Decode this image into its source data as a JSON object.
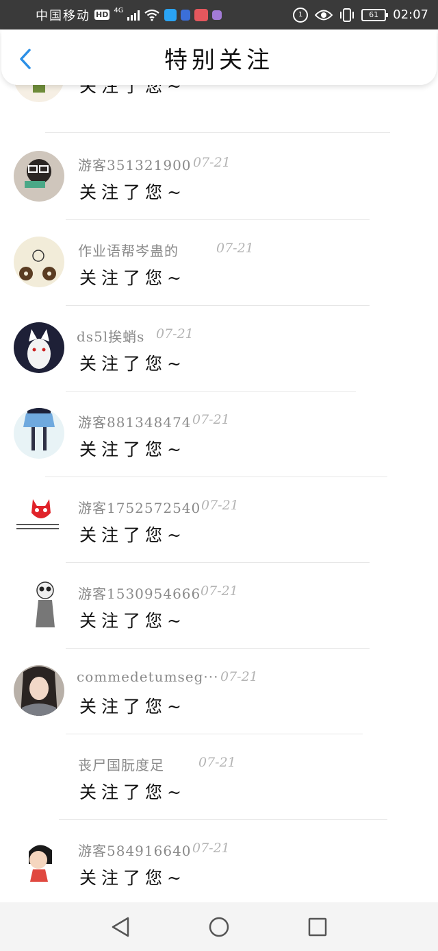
{
  "status_bar": {
    "carrier": "中国移动",
    "hd": "HD",
    "network": "4G",
    "battery": "61",
    "time": "02:07",
    "round_icon": "1"
  },
  "header": {
    "title": "特别关注",
    "back_icon": "chevron-left-icon",
    "accent": "#2b8fe6"
  },
  "follows": [
    {
      "name": "",
      "date": "",
      "message": "关注了您~",
      "avatar": "girl-green-avatar"
    },
    {
      "name": "游客351321900",
      "date": "07-21",
      "message": "关注了您~",
      "avatar": "glasses-person-avatar"
    },
    {
      "name": "作业语帮岑蛊的",
      "date": "07-21",
      "message": "关注了您~",
      "avatar": "doodle-donut-avatar"
    },
    {
      "name": "ds5l挨蛸s",
      "date": "07-21",
      "message": "关注了您~",
      "avatar": "anime-cat-avatar"
    },
    {
      "name": "游客881348474",
      "date": "07-21",
      "message": "关注了您~",
      "avatar": "skirt-legs-avatar"
    },
    {
      "name": "游客1752572540",
      "date": "07-21",
      "message": "关注了您~",
      "avatar": "red-fox-avatar"
    },
    {
      "name": "游客1530954666",
      "date": "07-21",
      "message": "关注了您~",
      "avatar": "panda-sketch-avatar"
    },
    {
      "name": "commedetumseg···",
      "date": "07-21",
      "message": "关注了您~",
      "avatar": "girl-portrait-avatar"
    },
    {
      "name": "丧尸国朊度足",
      "date": "07-21",
      "message": "关注了您~",
      "avatar": "blank-avatar"
    },
    {
      "name": "游客584916640",
      "date": "07-21",
      "message": "关注了您~",
      "avatar": "cartoon-girl-avatar"
    }
  ],
  "nav": {
    "back": "back-triangle-icon",
    "home": "home-circle-icon",
    "recents": "recents-square-icon"
  }
}
